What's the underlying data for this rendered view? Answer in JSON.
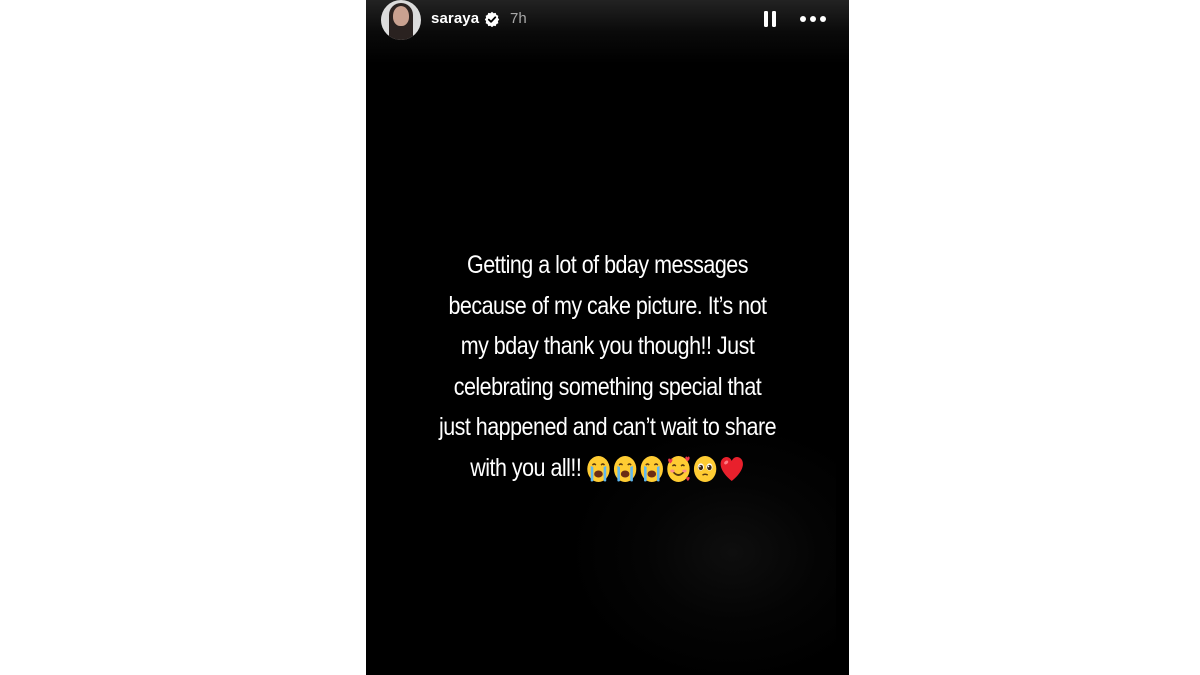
{
  "story": {
    "username": "saraya",
    "timestamp": "7h",
    "verified": true,
    "text_lines": [
      "Getting a lot of bday messages",
      "because of my cake picture. It’s not",
      "my bday thank you though!! Just",
      "celebrating something special that",
      "just happened and can’t wait to share",
      "with you all!!"
    ],
    "emojis": [
      "loudly-crying-face",
      "loudly-crying-face",
      "loudly-crying-face",
      "smiling-face-with-hearts",
      "pleading-face",
      "red-heart"
    ]
  },
  "colors": {
    "story_background": "#000000",
    "page_background": "#ffffff",
    "text": "#ffffff",
    "timestamp": "#a8a8a8",
    "verified_badge": "#ffffff"
  },
  "icons": {
    "verified": "verified-badge-icon",
    "pause": "pause-icon",
    "more": "more-options-icon"
  }
}
